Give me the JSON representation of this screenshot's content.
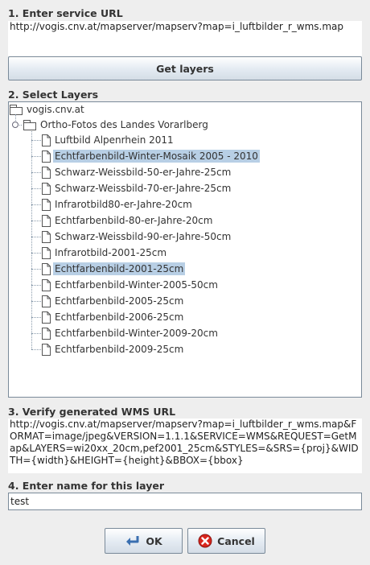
{
  "section1": {
    "label": "1. Enter service URL",
    "url": "http://vogis.cnv.at/mapserver/mapserv?map=i_luftbilder_r_wms.map",
    "get_layers_label": "Get layers"
  },
  "section2": {
    "label": "2. Select Layers",
    "root": "vogis.cnv.at",
    "folder": "Ortho-Fotos des Landes Vorarlberg",
    "layers": [
      {
        "label": "Luftbild Alpenrhein 2011",
        "selected": false
      },
      {
        "label": "Echtfarbenbild-Winter-Mosaik 2005 - 2010",
        "selected": true
      },
      {
        "label": "Schwarz-Weissbild-50-er-Jahre-25cm",
        "selected": false
      },
      {
        "label": "Schwarz-Weissbild-70-er-Jahre-25cm",
        "selected": false
      },
      {
        "label": "Infrarotbild80-er-Jahre-20cm",
        "selected": false
      },
      {
        "label": "Echtfarbenbild-80-er-Jahre-20cm",
        "selected": false
      },
      {
        "label": "Schwarz-Weissbild-90-er-Jahre-50cm",
        "selected": false
      },
      {
        "label": "Infrarotbild-2001-25cm",
        "selected": false
      },
      {
        "label": "Echtfarbenbild-2001-25cm",
        "selected": true
      },
      {
        "label": "Echtfarbenbild-Winter-2005-50cm",
        "selected": false
      },
      {
        "label": "Echtfarbenbild-2005-25cm",
        "selected": false
      },
      {
        "label": "Echtfarbenbild-2006-25cm",
        "selected": false
      },
      {
        "label": "Echtfarbenbild-Winter-2009-20cm",
        "selected": false
      },
      {
        "label": "Echtfarbenbild-2009-25cm",
        "selected": false
      }
    ]
  },
  "section3": {
    "label": "3. Verify generated WMS URL",
    "url": "http://vogis.cnv.at/mapserver/mapserv?map=i_luftbilder_r_wms.map&FORMAT=image/jpeg&VERSION=1.1.1&SERVICE=WMS&REQUEST=GetMap&LAYERS=wi20xx_20cm,pef2001_25cm&STYLES=&SRS={proj}&WIDTH={width}&HEIGHT={height}&BBOX={bbox}"
  },
  "section4": {
    "label": "4. Enter name for this layer",
    "value": "test"
  },
  "buttons": {
    "ok": "OK",
    "cancel": "Cancel"
  },
  "colors": {
    "selection": "#b8cfe5",
    "background": "#eeeeee"
  }
}
